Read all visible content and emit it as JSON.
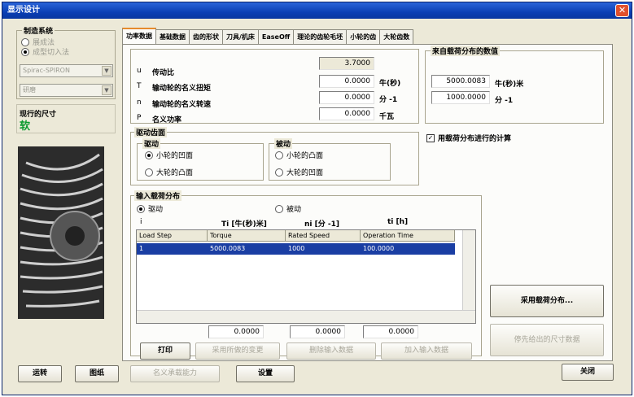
{
  "window": {
    "title": "显示设计",
    "close_glyph": "✕"
  },
  "system": {
    "label": "制造系统",
    "radio1": "展成法",
    "radio2": "成型切入法",
    "combo1": "Spirac-SPIRON",
    "combo2": "研磨"
  },
  "unit_box": {
    "label": "现行的尺寸",
    "value": "软"
  },
  "tabs": [
    "功率数据",
    "基础数据",
    "齿的形状",
    "刀具/机床",
    "EaseOff",
    "理论的齿轮毛坯",
    "小轮的齿",
    "大轮齿数"
  ],
  "power": {
    "rows": [
      {
        "sym": "u",
        "name": "传动比",
        "value": "3.7000",
        "unit": ""
      },
      {
        "sym": "T",
        "name": "输动轮的名义扭矩",
        "value": "0.0000",
        "unit": "牛(秒)"
      },
      {
        "sym": "n",
        "name": "输动轮的名义转速",
        "value": "0.0000",
        "unit": "分 -1"
      },
      {
        "sym": "P",
        "name": "名义功率",
        "value": "0.0000",
        "unit": "千瓦"
      }
    ]
  },
  "load_box": {
    "label": "来自载荷分布的数值",
    "value1": "5000.0083",
    "unit1": "牛(秒)米",
    "value2": "1000.0000",
    "unit2": "分 -1"
  },
  "use_load_check": {
    "label": "用载荷分布进行的计算",
    "mark": "✓"
  },
  "driving": {
    "label": "驱动齿面",
    "drive_label": "驱动",
    "drive1": "小轮的凹面",
    "drive2": "大轮的凸面",
    "driven_label": "被动",
    "driven1": "小轮的凸面",
    "driven2": "大轮的凹面"
  },
  "input_load": {
    "label": "输入载荷分布",
    "radio1": "驱动",
    "radio2": "被动",
    "h_index": "i",
    "h_torque": "Ti [牛(秒)米]",
    "h_speed": "ni [分 -1]",
    "h_time": "ti [h]",
    "columns": [
      "Load Step",
      "Torque",
      "Rated Speed",
      "Operation Time"
    ],
    "row": [
      "1",
      "5000.0083",
      "1000",
      "100.0000"
    ],
    "sum_torque": "0.0000",
    "sum_speed": "0.0000",
    "sum_time": "0.0000"
  },
  "buttons": {
    "print": "打印",
    "apply_changes": "采用所做的变更",
    "delete_input": "删除输入数据",
    "add_input": "加入输入数据",
    "use_load": "采用载荷分布...",
    "prev_size": "停先给出的尺寸数据",
    "calc": "运转",
    "drawing": "图纸",
    "nominal_capacity": "名义承载能力",
    "settings": "设置",
    "close": "关闭"
  }
}
